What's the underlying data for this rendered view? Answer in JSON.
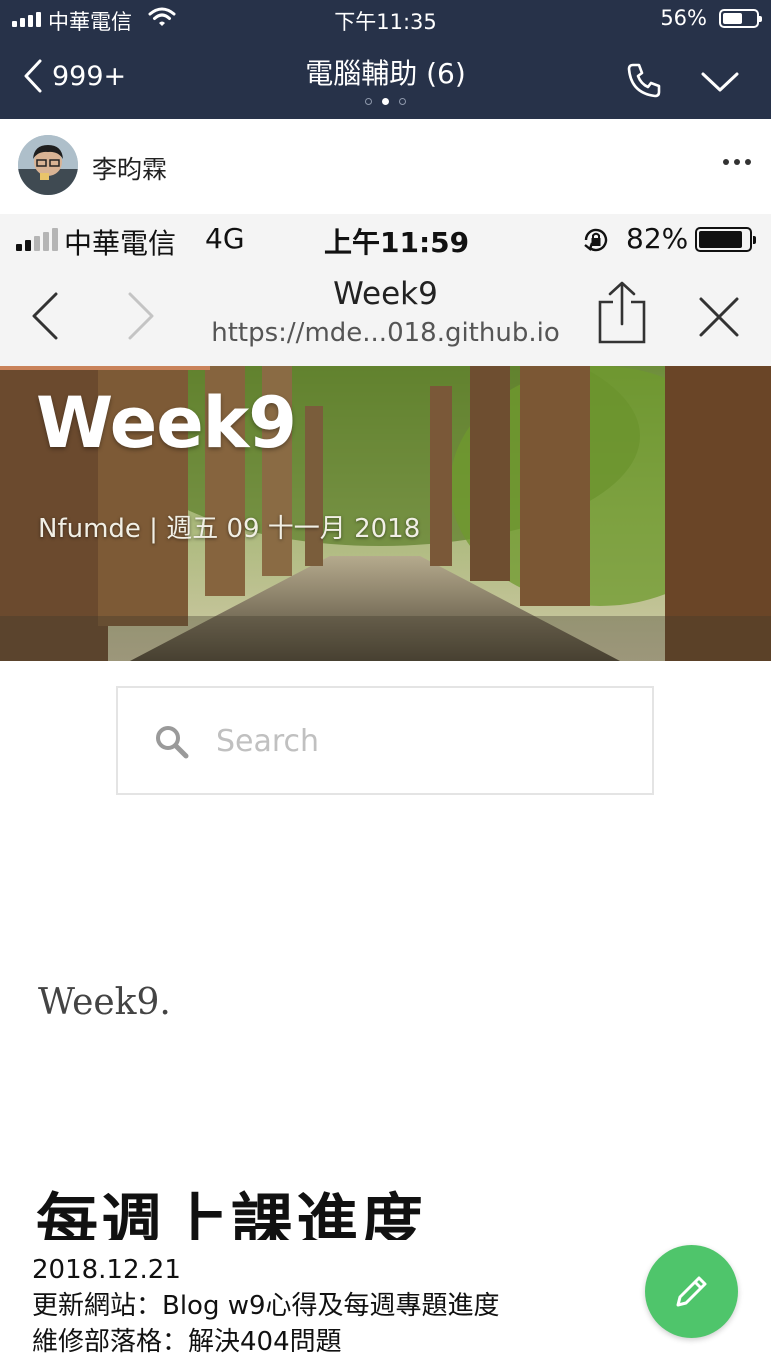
{
  "status_bar": {
    "carrier": "中華電信",
    "time": "下午11:35",
    "battery": "56%"
  },
  "header": {
    "back_count": "999+",
    "title": "電腦輔助 (6)"
  },
  "sender": {
    "name": "李昀霖"
  },
  "shared_screenshot": {
    "status_bar": {
      "carrier": "中華電信",
      "network": "4G",
      "time": "上午11:59",
      "battery": "82%"
    },
    "browser": {
      "title": "Week9",
      "url": "https://mde...018.github.io"
    },
    "hero": {
      "title": "Week9",
      "meta": "Nfumde | 週五 09 十一月 2018"
    },
    "search": {
      "placeholder": "Search"
    },
    "post_title": "Week9.",
    "heading": "每週上課進度"
  },
  "message": {
    "lines": [
      "2018.12.21",
      "更新網站：Blog w9心得及每週專題進度",
      "維修部落格：解決404問題"
    ]
  },
  "colors": {
    "header_bg": "#273249",
    "fab": "#4fc56b"
  }
}
